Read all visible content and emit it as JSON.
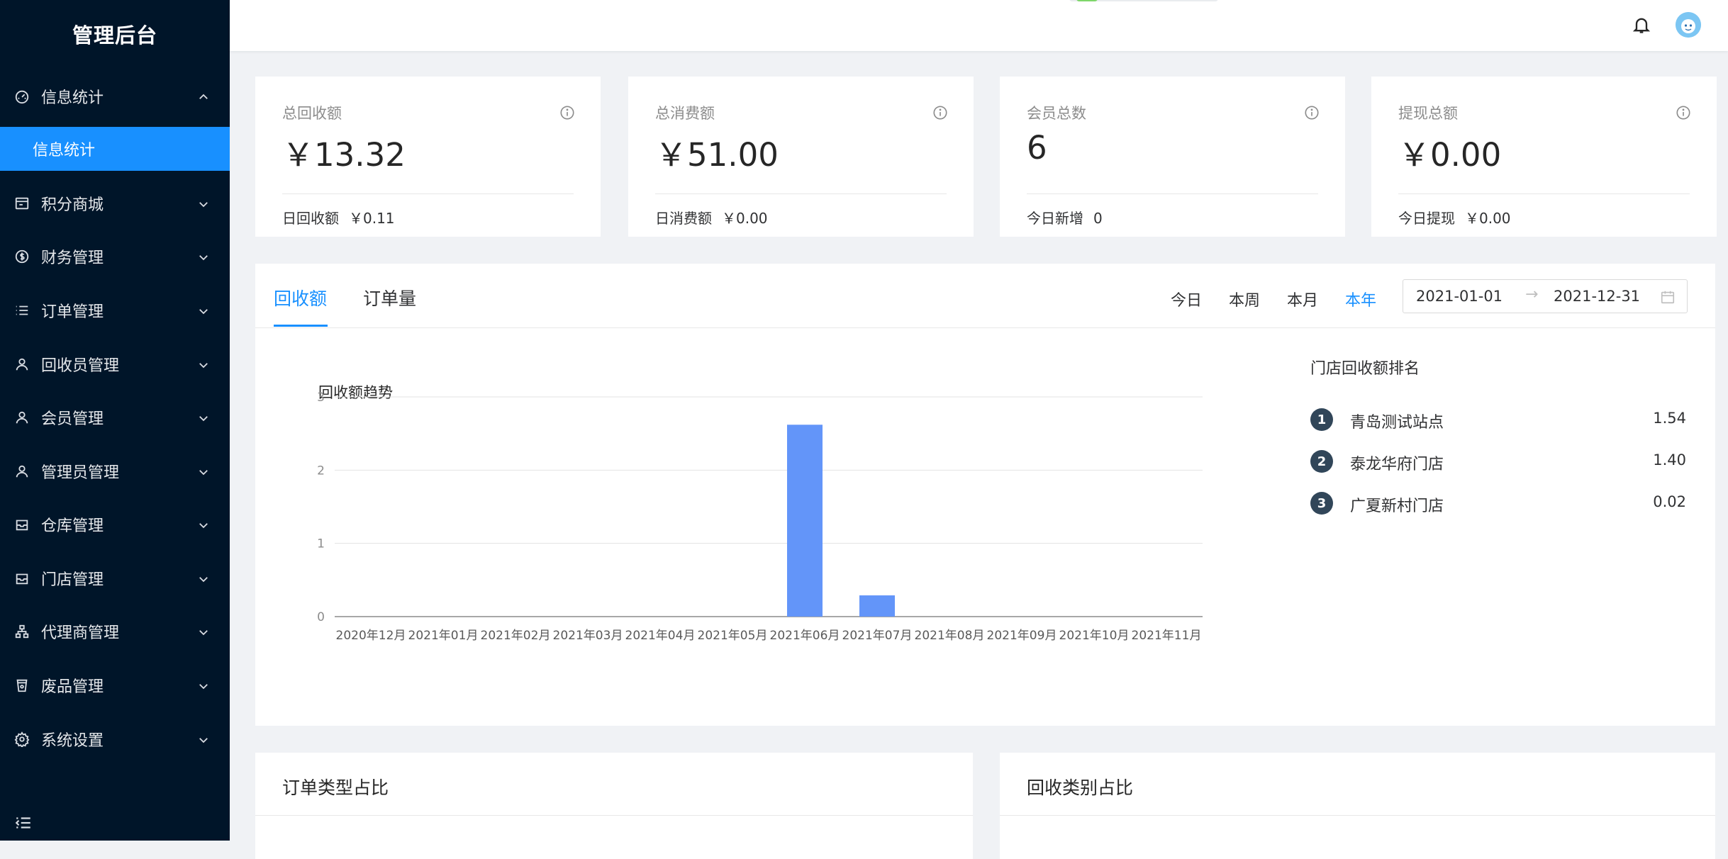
{
  "app": {
    "title": "管理后台"
  },
  "sidebar": {
    "items": [
      {
        "label": "信息统计",
        "icon": "dashboard-icon",
        "expanded": true
      },
      {
        "label": "积分商城",
        "icon": "shop-icon"
      },
      {
        "label": "财务管理",
        "icon": "dollar-icon"
      },
      {
        "label": "订单管理",
        "icon": "list-icon"
      },
      {
        "label": "回收员管理",
        "icon": "user-icon"
      },
      {
        "label": "会员管理",
        "icon": "user-icon"
      },
      {
        "label": "管理员管理",
        "icon": "user-icon"
      },
      {
        "label": "仓库管理",
        "icon": "inbox-icon"
      },
      {
        "label": "门店管理",
        "icon": "inbox-icon"
      },
      {
        "label": "代理商管理",
        "icon": "cluster-icon"
      },
      {
        "label": "废品管理",
        "icon": "recycle-bin-icon"
      },
      {
        "label": "系统设置",
        "icon": "gear-icon"
      }
    ],
    "submenu": {
      "label": "信息统计",
      "active": true
    }
  },
  "stats": [
    {
      "title": "总回收额",
      "value": "￥13.32",
      "footer_label": "日回收额",
      "footer_value": "￥0.11"
    },
    {
      "title": "总消费额",
      "value": "￥51.00",
      "footer_label": "日消费额",
      "footer_value": "￥0.00"
    },
    {
      "title": "会员总数",
      "value": "6",
      "footer_label": "今日新增",
      "footer_value": "0"
    },
    {
      "title": "提现总额",
      "value": "￥0.00",
      "footer_label": "今日提现",
      "footer_value": "￥0.00"
    }
  ],
  "chart_panel": {
    "tabs": [
      {
        "label": "回收额",
        "active": true
      },
      {
        "label": "订单量",
        "active": false
      }
    ],
    "ranges": [
      {
        "label": "今日",
        "active": false
      },
      {
        "label": "本周",
        "active": false
      },
      {
        "label": "本月",
        "active": false
      },
      {
        "label": "本年",
        "active": true
      }
    ],
    "date_start": "2021-01-01",
    "date_separator": "→",
    "date_end": "2021-12-31",
    "ranking_title": "门店回收额排名",
    "ranking": [
      {
        "rank": "1",
        "name": "青岛测试站点",
        "value": "1.54"
      },
      {
        "rank": "2",
        "name": "泰龙华府门店",
        "value": "1.40"
      },
      {
        "rank": "3",
        "name": "广夏新村门店",
        "value": "0.02"
      }
    ]
  },
  "chart_data": {
    "type": "bar",
    "title": "回收额趋势",
    "categories": [
      "2020年12月",
      "2021年01月",
      "2021年02月",
      "2021年03月",
      "2021年04月",
      "2021年05月",
      "2021年06月",
      "2021年07月",
      "2021年08月",
      "2021年09月",
      "2021年10月",
      "2021年11月"
    ],
    "values": [
      0,
      0,
      0,
      0,
      0,
      0,
      2.62,
      0.29,
      0,
      0,
      0,
      0
    ],
    "ylim": [
      0,
      3
    ],
    "yticks": [
      0,
      1,
      2,
      3
    ],
    "grid": true,
    "bar_color": "#6395f9"
  },
  "bottom_cards": [
    {
      "title": "订单类型占比"
    },
    {
      "title": "回收类别占比"
    }
  ],
  "colors": {
    "sidebar_bg": "#001529",
    "accent": "#1890ff",
    "rank_badge": "#314659"
  }
}
